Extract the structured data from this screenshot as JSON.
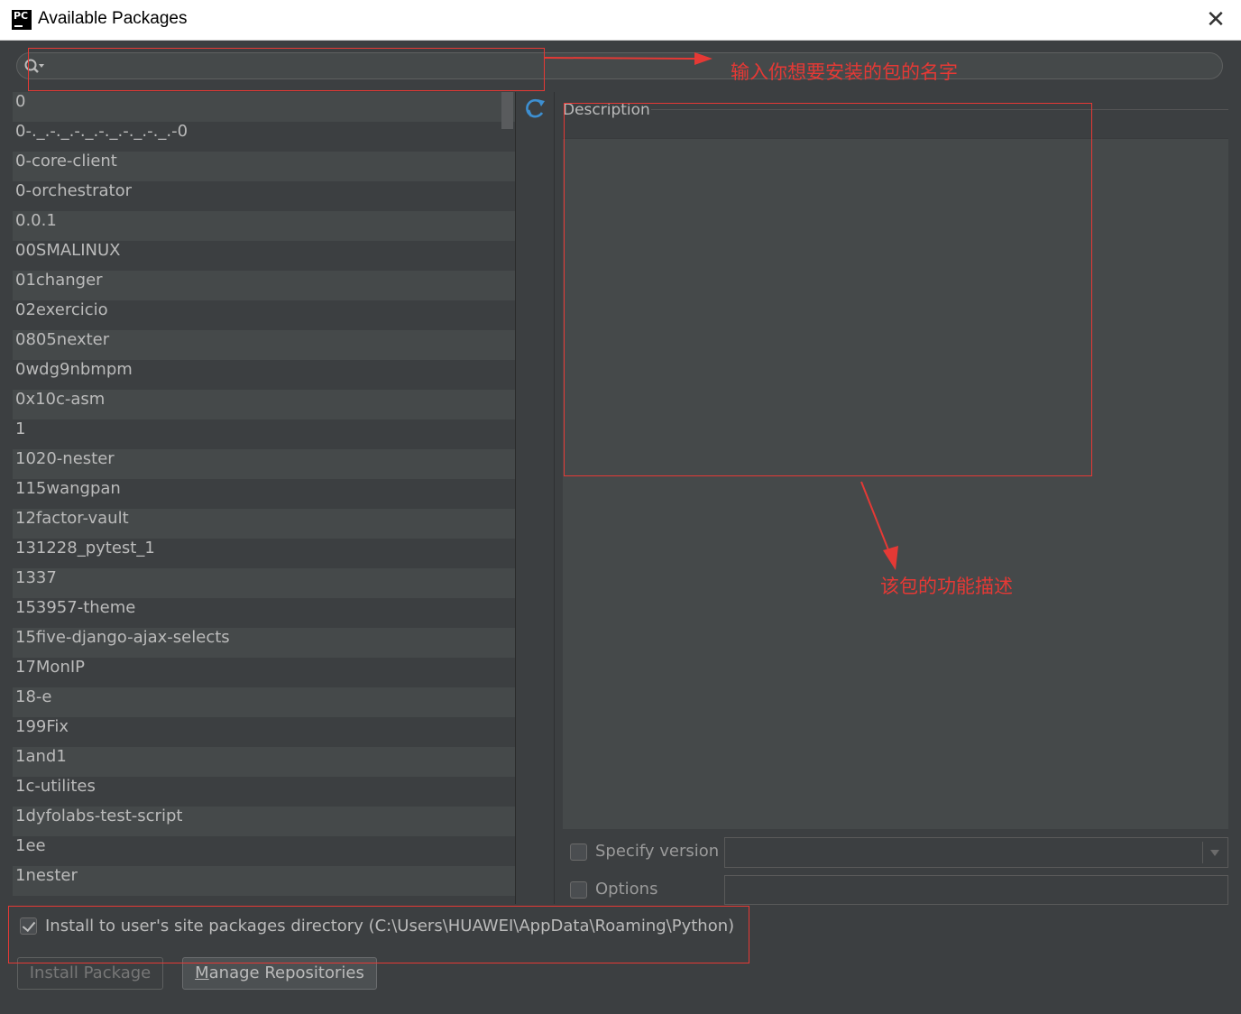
{
  "window": {
    "title": "Available Packages",
    "app_icon_text": "PC",
    "close_glyph": "✕"
  },
  "search": {
    "value": "",
    "placeholder": ""
  },
  "packages": [
    "0",
    "0-._.-._.-._.-._.-._.-._.-0",
    "0-core-client",
    "0-orchestrator",
    "0.0.1",
    "00SMALINUX",
    "01changer",
    "02exercicio",
    "0805nexter",
    "0wdg9nbmpm",
    "0x10c-asm",
    "1",
    "1020-nester",
    "115wangpan",
    "12factor-vault",
    "131228_pytest_1",
    "1337",
    "153957-theme",
    "15five-django-ajax-selects",
    "17MonIP",
    "18-e",
    "199Fix",
    "1and1",
    "1c-utilites",
    "1dyfolabs-test-script",
    "1ee",
    "1nester"
  ],
  "description": {
    "label": "Description",
    "text": ""
  },
  "options": {
    "specify_version_label": "Specify version",
    "specify_version_checked": false,
    "version_value": "",
    "options_label": "Options",
    "options_checked": false,
    "options_value": "",
    "install_user_label": "Install to user's site packages directory (C:\\Users\\HUAWEI\\AppData\\Roaming\\Python)",
    "install_user_checked": true
  },
  "buttons": {
    "install_label": "Install Package",
    "manage_label": "Manage Repositories"
  },
  "annotations": {
    "search_note": "输入你想要安装的包的名字",
    "description_note": "该包的功能描述"
  },
  "colors": {
    "annotation": "#e53935",
    "background": "#3c3f41",
    "accent_icon": "#3d8fd1"
  }
}
